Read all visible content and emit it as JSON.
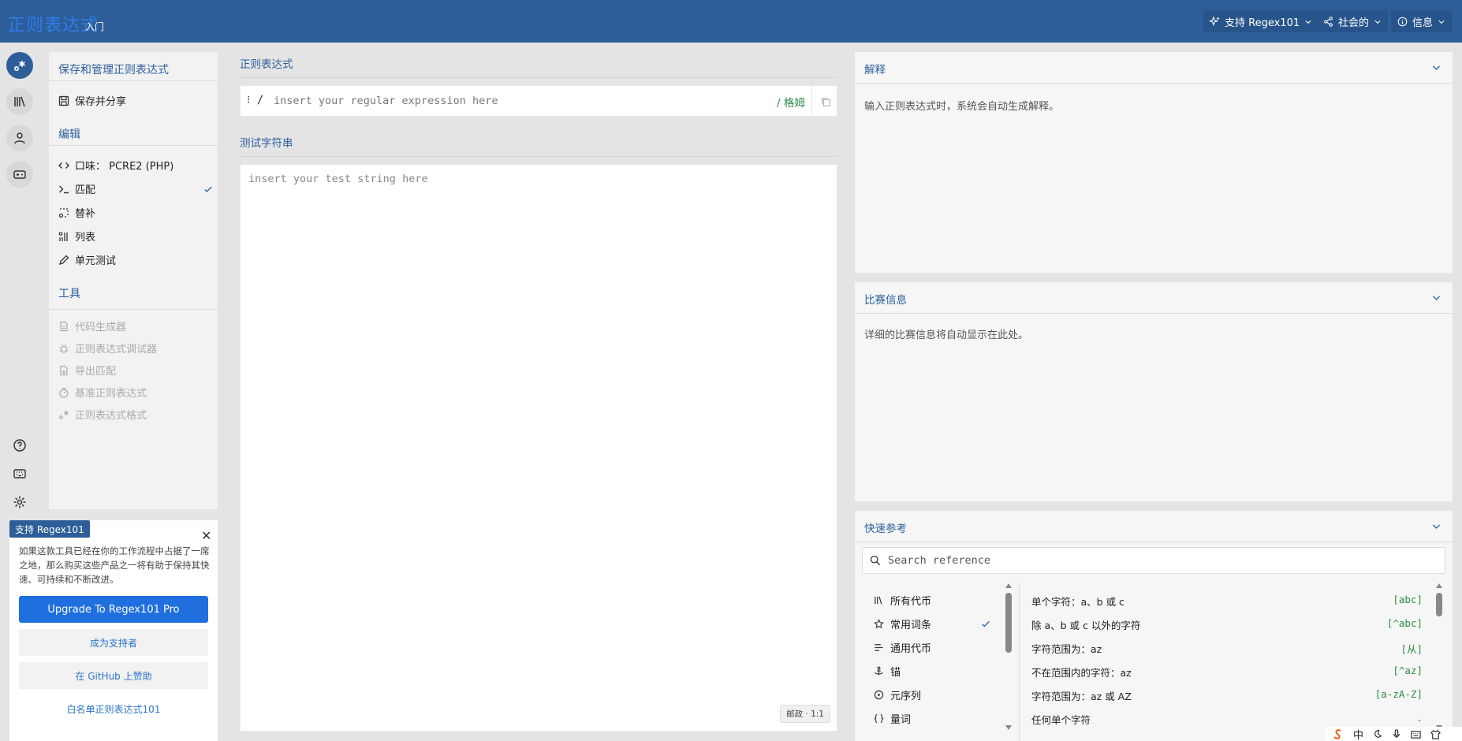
{
  "topbar": {
    "logo_text": "正则表达式",
    "intro_label": "入门",
    "support_label": "支持 Regex101",
    "social_label": "社会的",
    "info_label": "信息"
  },
  "sidebar": {
    "save_heading": "保存和管理正则表达式",
    "save_share": "保存并分享",
    "edit_heading": "编辑",
    "flavor": "口味： PCRE2 (PHP)",
    "match": "匹配",
    "substitute": "替补",
    "list": "列表",
    "unit_tests": "单元测试",
    "tools_heading": "工具",
    "tools": [
      "代码生成器",
      "正则表达式调试器",
      "导出匹配",
      "基准正则表达式",
      "正则表达式格式"
    ]
  },
  "promo": {
    "tag": "支持 Regex101",
    "text": "如果这款工具已经在你的工作流程中占据了一席之地，那么购买这些产品之一将有助于保持其快速、可持续和不断改进。",
    "upgrade": "Upgrade To Regex101 Pro",
    "sponsor": "成为支持者",
    "github": "在 GitHub 上赞助",
    "whitelist": "白名单正则表达式101"
  },
  "regex": {
    "label": "正则表达式",
    "delimiter": "⁝ /",
    "placeholder": "insert your regular expression here",
    "flags": "/ 格姆"
  },
  "test": {
    "label": "测试字符串",
    "placeholder": "insert your test string here",
    "position": "邮政 · 1:1"
  },
  "explanation": {
    "title": "解释",
    "body": "输入正则表达式时，系统会自动生成解释。"
  },
  "match_info": {
    "title": "比赛信息",
    "body": "详细的比赛信息将自动显示在此处。"
  },
  "quick_ref": {
    "title": "快速参考",
    "search_placeholder": "Search reference",
    "categories": [
      "所有代币",
      "常用词条",
      "通用代币",
      "锚",
      "元序列",
      "量词"
    ],
    "entries": [
      {
        "desc": "单个字符：a、b 或 c",
        "code": "[abc]"
      },
      {
        "desc": "除 a、b 或 c 以外的字符",
        "code": "[^abc]"
      },
      {
        "desc": "字符范围为：az",
        "code": "[从]"
      },
      {
        "desc": "不在范围内的字符：az",
        "code": "[^az]"
      },
      {
        "desc": "字符范围为：az 或 AZ",
        "code": "[a-zA-Z]"
      },
      {
        "desc": "任何单个字符",
        "code": "."
      }
    ]
  },
  "ime": {
    "lang": "中"
  },
  "colors": {
    "topbar": "#2d5e99",
    "accent": "#2a5f9e",
    "primary_button": "#1f6fde",
    "code_green": "#2a8c44"
  }
}
